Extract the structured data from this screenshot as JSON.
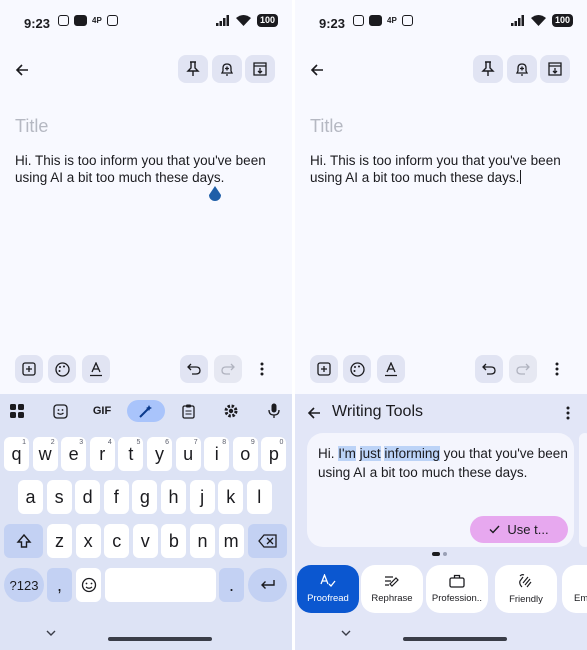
{
  "left": {
    "status": {
      "time": "9:23",
      "badge": "4P",
      "battery": "100"
    },
    "note": {
      "title_placeholder": "Title",
      "body": "Hi. This is too inform you that you've been using AI a bit too much these days."
    },
    "keyboard": {
      "gif_label": "GIF",
      "row1": [
        {
          "k": "q",
          "n": "1"
        },
        {
          "k": "w",
          "n": "2"
        },
        {
          "k": "e",
          "n": "3"
        },
        {
          "k": "r",
          "n": "4"
        },
        {
          "k": "t",
          "n": "5"
        },
        {
          "k": "y",
          "n": "6"
        },
        {
          "k": "u",
          "n": "7"
        },
        {
          "k": "i",
          "n": "8"
        },
        {
          "k": "o",
          "n": "9"
        },
        {
          "k": "p",
          "n": "0"
        }
      ],
      "row2": [
        "a",
        "s",
        "d",
        "f",
        "g",
        "h",
        "j",
        "k",
        "l"
      ],
      "row3": [
        "z",
        "x",
        "c",
        "v",
        "b",
        "n",
        "m"
      ],
      "sym_label": "?123",
      "comma": ",",
      "period": "."
    }
  },
  "right": {
    "status": {
      "time": "9:23",
      "badge": "4P",
      "battery": "100"
    },
    "note": {
      "title_placeholder": "Title",
      "body": "Hi. This is too inform you that you've been using AI a bit too much these days."
    },
    "writing_tools": {
      "title": "Writing Tools",
      "suggestion": {
        "before": "Hi. ",
        "hl1": "I'm",
        "mid1": " ",
        "hl2": "just",
        "mid2": " ",
        "hl3": "informing",
        "after": " you that you've been using AI a bit too much these days."
      },
      "use_button": "Use t...",
      "chips": [
        {
          "label": "Proofread",
          "icon": "proofread-icon"
        },
        {
          "label": "Rephrase",
          "icon": "rephrase-icon"
        },
        {
          "label": "Profession..",
          "icon": "briefcase-icon"
        },
        {
          "label": "Friendly",
          "icon": "wave-hand-icon"
        },
        {
          "label": "Em",
          "icon": "emoji-icon"
        }
      ]
    }
  },
  "colors": {
    "accent": "#0b57d0",
    "use_button": "#e7a8ef",
    "highlight": "#bcd3f7"
  }
}
